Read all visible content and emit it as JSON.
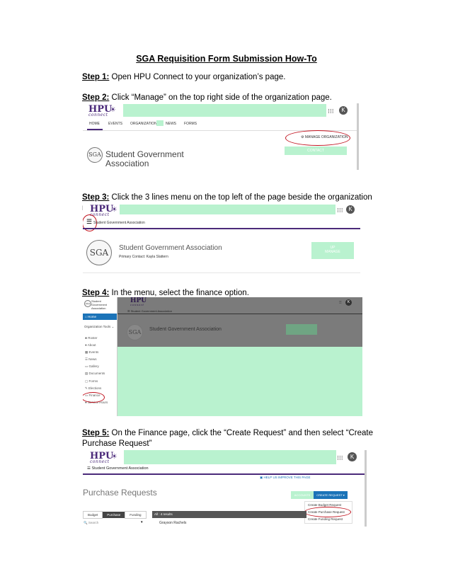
{
  "doc": {
    "title": "SGA Requisition Form Submission How-To",
    "steps": [
      {
        "label": "Step 1:",
        "text": " Open HPU Connect to your organization’s page."
      },
      {
        "label": "Step 2:",
        "text": " Click “Manage” on the top right side of the organization page."
      },
      {
        "label": "Step 3:",
        "text": " Click the 3 lines menu on the top left of the page beside the organization name"
      },
      {
        "label": "Step 4:",
        "text": " In the menu, select the finance option."
      },
      {
        "label": "Step 5:",
        "text": " On the Finance page, click the “Create Request” and then select “Create Purchase Request”"
      }
    ]
  },
  "brand": {
    "hpu": "HPU",
    "connect": "connect",
    "avatar": "K"
  },
  "shot2": {
    "nav": [
      "HOME",
      "EVENTS",
      "ORGANIZATIONS",
      "NEWS",
      "FORMS"
    ],
    "manage": "MANAGE ORGANIZATION",
    "contact": "CONTACT",
    "org_line1": "Student Government",
    "org_line2": "Association"
  },
  "shot3": {
    "crumb": "Student Government Association",
    "org": "Student Government Association",
    "primary": "Primary Contact: Kayla Slattern",
    "btn_top": "UP",
    "btn_bot": "MANAGE"
  },
  "shot4": {
    "sidebar_org": "Student Government Association",
    "home": "Home",
    "tools": "Organization Tools",
    "items": [
      "Roster",
      "About",
      "Events",
      "News",
      "Gallery",
      "Documents",
      "Forms",
      "Elections",
      "Finance",
      "Service Hours"
    ],
    "crumb": "Student Government Association",
    "org": "Student Government Association"
  },
  "shot5": {
    "crumb": "Student Government Association",
    "help": "HELP US IMPROVE THIS PAGE",
    "page_title": "Purchase Requests",
    "accounts": "ACCOUNTS",
    "create": "CREATE REQUEST",
    "menu": [
      "Create Budget Request",
      "Create Purchase Request",
      "Create Funding Request"
    ],
    "tabs": [
      "Budget",
      "Purchase",
      "Funding"
    ],
    "search": "Search",
    "results": "All : 4 results",
    "row1": "Grayson Rachels"
  },
  "colors": {
    "accent": "#4b2a7a",
    "highlight": "#b9f2cf",
    "circle": "#c0121e",
    "button": "#1b73b8"
  }
}
